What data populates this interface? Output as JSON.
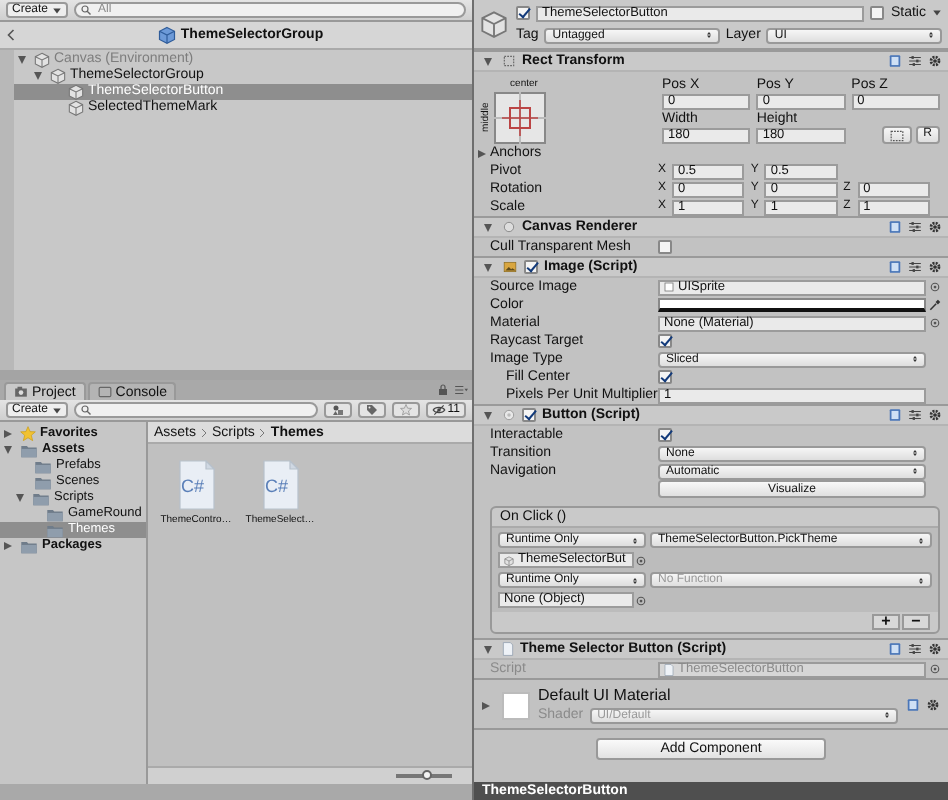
{
  "hierarchy": {
    "create_label": "Create",
    "search": {
      "placeholder": "All"
    },
    "scene_title": "ThemeSelectorGroup",
    "tree": [
      {
        "label": "Canvas (Environment)",
        "kind": "gameobject",
        "disabled": true,
        "selected": false,
        "expanded": true,
        "children": [
          {
            "label": "ThemeSelectorGroup",
            "kind": "gameobject",
            "disabled": false,
            "selected": false,
            "expanded": true,
            "children": [
              {
                "label": "ThemeSelectorButton",
                "kind": "gameobject",
                "disabled": false,
                "selected": true
              },
              {
                "label": "SelectedThemeMark",
                "kind": "gameobject",
                "disabled": false,
                "selected": false
              }
            ]
          }
        ]
      }
    ]
  },
  "project": {
    "tabs": [
      {
        "label": "Project",
        "kind": "project",
        "selected": true
      },
      {
        "label": "Console",
        "kind": "console",
        "selected": false
      }
    ],
    "create_label": "Create",
    "hidden_count": "11",
    "folders": [
      {
        "label": "Favorites",
        "kind": "favorites",
        "selected": false,
        "expanded": false
      },
      {
        "label": "Assets",
        "kind": "section",
        "selected": false,
        "expanded": true,
        "children": [
          {
            "label": "Prefabs",
            "kind": "folder",
            "selected": false
          },
          {
            "label": "Scenes",
            "kind": "folder",
            "selected": false
          },
          {
            "label": "Scripts",
            "kind": "folder",
            "selected": false,
            "expanded": true,
            "children": [
              {
                "label": "GameRound",
                "kind": "folder",
                "selected": false
              },
              {
                "label": "Themes",
                "kind": "folder",
                "selected": true
              }
            ]
          }
        ]
      },
      {
        "label": "Packages",
        "kind": "section",
        "selected": false,
        "expanded": false
      }
    ],
    "breadcrumb": [
      {
        "label": "Assets",
        "current": false
      },
      {
        "label": "Scripts",
        "current": false
      },
      {
        "label": "Themes",
        "current": true
      }
    ],
    "files": [
      {
        "name": "ThemeContro…",
        "type_label": "C#"
      },
      {
        "name": "ThemeSelect…",
        "type_label": "C#"
      }
    ],
    "zoom": {
      "level": 0.55
    }
  },
  "inspector": {
    "object": {
      "enabled": true,
      "name": "ThemeSelectorButton",
      "static": false,
      "static_label": "Static",
      "tag_label": "Tag",
      "tag": "Untagged",
      "layer_label": "Layer",
      "layer": "UI"
    },
    "components": [
      {
        "kind": "rect_transform",
        "title": "Rect Transform",
        "expanded": true,
        "anchor_h": "center",
        "anchor_v": "middle",
        "raw_label": "R",
        "fields": [
          {
            "label": "Pos X",
            "value": "0"
          },
          {
            "label": "Pos Y",
            "value": "0"
          },
          {
            "label": "Pos Z",
            "value": "0"
          },
          {
            "label": "Width",
            "value": "180"
          },
          {
            "label": "Height",
            "value": "180"
          }
        ],
        "rows": [
          {
            "kind": "foldout",
            "label": "Anchors",
            "expanded": false
          },
          {
            "kind": "vector",
            "label": "Pivot",
            "axes": [
              {
                "axis": "X",
                "value": "0.5"
              },
              {
                "axis": "Y",
                "value": "0.5"
              }
            ]
          },
          {
            "kind": "vector",
            "label": "Rotation",
            "axes": [
              {
                "axis": "X",
                "value": "0"
              },
              {
                "axis": "Y",
                "value": "0"
              },
              {
                "axis": "Z",
                "value": "0"
              }
            ]
          },
          {
            "kind": "vector",
            "label": "Scale",
            "axes": [
              {
                "axis": "X",
                "value": "1"
              },
              {
                "axis": "Y",
                "value": "1"
              },
              {
                "axis": "Z",
                "value": "1"
              }
            ]
          }
        ]
      },
      {
        "kind": "component",
        "title": "Canvas Renderer",
        "expanded": true,
        "rows": [
          {
            "kind": "checkbox",
            "label": "Cull Transparent Mesh",
            "checked": false
          }
        ]
      },
      {
        "kind": "component",
        "title": "Image (Script)",
        "expanded": true,
        "enabled": true,
        "rows": [
          {
            "kind": "object",
            "label": "Source Image",
            "value": "UISprite"
          },
          {
            "kind": "color",
            "label": "Color",
            "color": "#ffffff"
          },
          {
            "kind": "object",
            "label": "Material",
            "value": "None (Material)"
          },
          {
            "kind": "checkbox",
            "label": "Raycast Target",
            "checked": true
          },
          {
            "kind": "dropdown",
            "label": "Image Type",
            "value": "Sliced",
            "children": [
              {
                "kind": "checkbox",
                "label": "Fill Center",
                "checked": true
              },
              {
                "kind": "text",
                "label": "Pixels Per Unit Multiplier",
                "value": "1"
              }
            ]
          }
        ]
      },
      {
        "kind": "component",
        "title": "Button (Script)",
        "expanded": true,
        "enabled": true,
        "rows": [
          {
            "kind": "checkbox",
            "label": "Interactable",
            "checked": true
          },
          {
            "kind": "dropdown",
            "label": "Transition",
            "value": "None"
          },
          {
            "kind": "dropdown",
            "label": "Navigation",
            "value": "Automatic"
          },
          {
            "kind": "button",
            "value": "Visualize"
          },
          {
            "kind": "event",
            "label": "On Click ()",
            "add_label": "+",
            "remove_label": "−",
            "listeners": [
              {
                "mode": "Runtime Only",
                "function": "ThemeSelectorButton.PickTheme",
                "function_disabled": false,
                "target": "ThemeSelectorBut"
              },
              {
                "mode": "Runtime Only",
                "function": "No Function",
                "function_disabled": true,
                "target": "None (Object)"
              }
            ]
          }
        ]
      },
      {
        "kind": "component",
        "title": "Theme Selector Button (Script)",
        "expanded": true,
        "rows": [
          {
            "kind": "object",
            "label": "Script",
            "value": "ThemeSelectorButton",
            "disabled": true
          }
        ]
      },
      {
        "kind": "material",
        "title": "Default UI Material",
        "shader_label": "Shader",
        "shader": "UI/Default",
        "expanded": false
      }
    ],
    "add_component": "Add Component",
    "preview_title": "ThemeSelectorButton"
  }
}
